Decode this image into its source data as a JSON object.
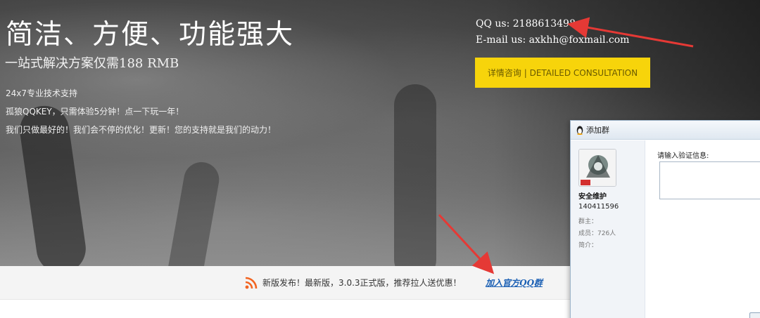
{
  "hero": {
    "title": "简洁、方便、功能强大",
    "subtitle": "一站式解决方案仅需188 RMB",
    "features": [
      "24x7专业技术支持",
      "孤狼QQKEY，只需体验5分钟！点一下玩一年！",
      "我们只做最好的！我们会不停的优化！更新！您的支持就是我们的动力！"
    ]
  },
  "contact": {
    "qq": "QQ us: 2188613498",
    "email": "E-mail us: axkhh@foxmail.com",
    "consult_button": "详情咨询 | DETAILED CONSULTATION",
    "button_color": "#f7d40b"
  },
  "news": {
    "icon": "rss-icon",
    "text": "新版发布！最新版，3.0.3正式版，推荐拉人送优惠！",
    "link": "加入官方QQ群",
    "rss_color": "#f26522"
  },
  "dialog": {
    "title": "添加群",
    "group_name": "安全维护",
    "group_id": "140411596",
    "owner_label": "群主：",
    "members_label": "成员：726人",
    "intro_label": "简介：",
    "verify_label": "请输入验证信息:",
    "verify_value": ""
  },
  "annotation_color": "#e53935"
}
